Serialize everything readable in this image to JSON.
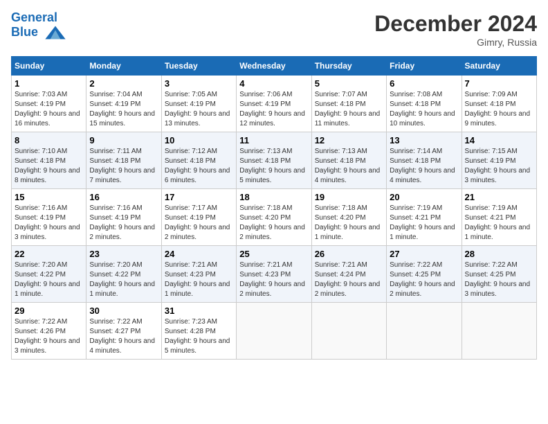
{
  "header": {
    "logo_line1": "General",
    "logo_line2": "Blue",
    "month": "December 2024",
    "location": "Gimry, Russia"
  },
  "days_of_week": [
    "Sunday",
    "Monday",
    "Tuesday",
    "Wednesday",
    "Thursday",
    "Friday",
    "Saturday"
  ],
  "weeks": [
    [
      {
        "day": "1",
        "sunrise": "Sunrise: 7:03 AM",
        "sunset": "Sunset: 4:19 PM",
        "daylight": "Daylight: 9 hours and 16 minutes."
      },
      {
        "day": "2",
        "sunrise": "Sunrise: 7:04 AM",
        "sunset": "Sunset: 4:19 PM",
        "daylight": "Daylight: 9 hours and 15 minutes."
      },
      {
        "day": "3",
        "sunrise": "Sunrise: 7:05 AM",
        "sunset": "Sunset: 4:19 PM",
        "daylight": "Daylight: 9 hours and 13 minutes."
      },
      {
        "day": "4",
        "sunrise": "Sunrise: 7:06 AM",
        "sunset": "Sunset: 4:19 PM",
        "daylight": "Daylight: 9 hours and 12 minutes."
      },
      {
        "day": "5",
        "sunrise": "Sunrise: 7:07 AM",
        "sunset": "Sunset: 4:18 PM",
        "daylight": "Daylight: 9 hours and 11 minutes."
      },
      {
        "day": "6",
        "sunrise": "Sunrise: 7:08 AM",
        "sunset": "Sunset: 4:18 PM",
        "daylight": "Daylight: 9 hours and 10 minutes."
      },
      {
        "day": "7",
        "sunrise": "Sunrise: 7:09 AM",
        "sunset": "Sunset: 4:18 PM",
        "daylight": "Daylight: 9 hours and 9 minutes."
      }
    ],
    [
      {
        "day": "8",
        "sunrise": "Sunrise: 7:10 AM",
        "sunset": "Sunset: 4:18 PM",
        "daylight": "Daylight: 9 hours and 8 minutes."
      },
      {
        "day": "9",
        "sunrise": "Sunrise: 7:11 AM",
        "sunset": "Sunset: 4:18 PM",
        "daylight": "Daylight: 9 hours and 7 minutes."
      },
      {
        "day": "10",
        "sunrise": "Sunrise: 7:12 AM",
        "sunset": "Sunset: 4:18 PM",
        "daylight": "Daylight: 9 hours and 6 minutes."
      },
      {
        "day": "11",
        "sunrise": "Sunrise: 7:13 AM",
        "sunset": "Sunset: 4:18 PM",
        "daylight": "Daylight: 9 hours and 5 minutes."
      },
      {
        "day": "12",
        "sunrise": "Sunrise: 7:13 AM",
        "sunset": "Sunset: 4:18 PM",
        "daylight": "Daylight: 9 hours and 4 minutes."
      },
      {
        "day": "13",
        "sunrise": "Sunrise: 7:14 AM",
        "sunset": "Sunset: 4:18 PM",
        "daylight": "Daylight: 9 hours and 4 minutes."
      },
      {
        "day": "14",
        "sunrise": "Sunrise: 7:15 AM",
        "sunset": "Sunset: 4:19 PM",
        "daylight": "Daylight: 9 hours and 3 minutes."
      }
    ],
    [
      {
        "day": "15",
        "sunrise": "Sunrise: 7:16 AM",
        "sunset": "Sunset: 4:19 PM",
        "daylight": "Daylight: 9 hours and 3 minutes."
      },
      {
        "day": "16",
        "sunrise": "Sunrise: 7:16 AM",
        "sunset": "Sunset: 4:19 PM",
        "daylight": "Daylight: 9 hours and 2 minutes."
      },
      {
        "day": "17",
        "sunrise": "Sunrise: 7:17 AM",
        "sunset": "Sunset: 4:19 PM",
        "daylight": "Daylight: 9 hours and 2 minutes."
      },
      {
        "day": "18",
        "sunrise": "Sunrise: 7:18 AM",
        "sunset": "Sunset: 4:20 PM",
        "daylight": "Daylight: 9 hours and 2 minutes."
      },
      {
        "day": "19",
        "sunrise": "Sunrise: 7:18 AM",
        "sunset": "Sunset: 4:20 PM",
        "daylight": "Daylight: 9 hours and 1 minute."
      },
      {
        "day": "20",
        "sunrise": "Sunrise: 7:19 AM",
        "sunset": "Sunset: 4:21 PM",
        "daylight": "Daylight: 9 hours and 1 minute."
      },
      {
        "day": "21",
        "sunrise": "Sunrise: 7:19 AM",
        "sunset": "Sunset: 4:21 PM",
        "daylight": "Daylight: 9 hours and 1 minute."
      }
    ],
    [
      {
        "day": "22",
        "sunrise": "Sunrise: 7:20 AM",
        "sunset": "Sunset: 4:22 PM",
        "daylight": "Daylight: 9 hours and 1 minute."
      },
      {
        "day": "23",
        "sunrise": "Sunrise: 7:20 AM",
        "sunset": "Sunset: 4:22 PM",
        "daylight": "Daylight: 9 hours and 1 minute."
      },
      {
        "day": "24",
        "sunrise": "Sunrise: 7:21 AM",
        "sunset": "Sunset: 4:23 PM",
        "daylight": "Daylight: 9 hours and 1 minute."
      },
      {
        "day": "25",
        "sunrise": "Sunrise: 7:21 AM",
        "sunset": "Sunset: 4:23 PM",
        "daylight": "Daylight: 9 hours and 2 minutes."
      },
      {
        "day": "26",
        "sunrise": "Sunrise: 7:21 AM",
        "sunset": "Sunset: 4:24 PM",
        "daylight": "Daylight: 9 hours and 2 minutes."
      },
      {
        "day": "27",
        "sunrise": "Sunrise: 7:22 AM",
        "sunset": "Sunset: 4:25 PM",
        "daylight": "Daylight: 9 hours and 2 minutes."
      },
      {
        "day": "28",
        "sunrise": "Sunrise: 7:22 AM",
        "sunset": "Sunset: 4:25 PM",
        "daylight": "Daylight: 9 hours and 3 minutes."
      }
    ],
    [
      {
        "day": "29",
        "sunrise": "Sunrise: 7:22 AM",
        "sunset": "Sunset: 4:26 PM",
        "daylight": "Daylight: 9 hours and 3 minutes."
      },
      {
        "day": "30",
        "sunrise": "Sunrise: 7:22 AM",
        "sunset": "Sunset: 4:27 PM",
        "daylight": "Daylight: 9 hours and 4 minutes."
      },
      {
        "day": "31",
        "sunrise": "Sunrise: 7:23 AM",
        "sunset": "Sunset: 4:28 PM",
        "daylight": "Daylight: 9 hours and 5 minutes."
      },
      null,
      null,
      null,
      null
    ]
  ]
}
